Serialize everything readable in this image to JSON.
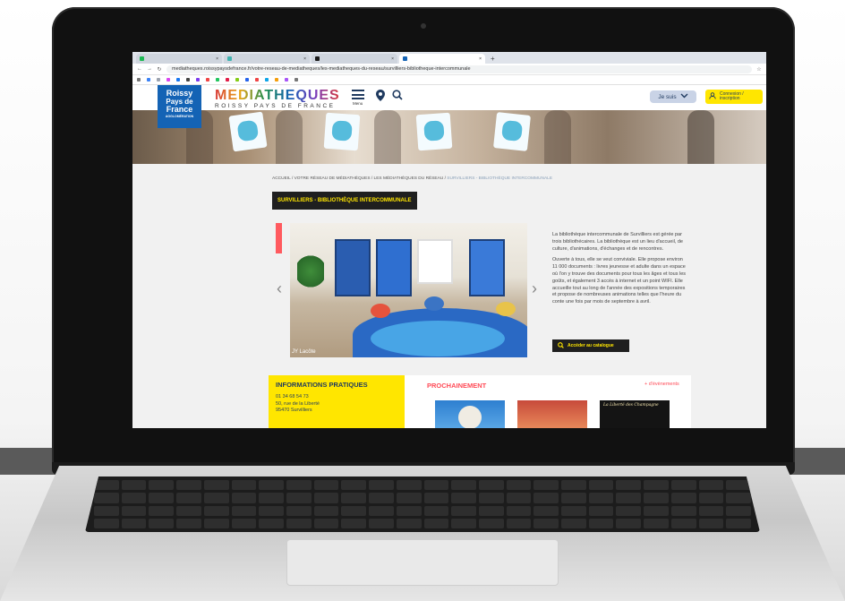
{
  "browser": {
    "tabs": [
      {
        "label": "",
        "active": false,
        "color": "#1db954"
      },
      {
        "label": "",
        "active": false,
        "color": "#3fb3b0"
      },
      {
        "label": "",
        "active": false,
        "color": "#1a1a1a"
      },
      {
        "label": "",
        "active": true,
        "color": "#1463b5"
      }
    ],
    "new_tab_label": "+",
    "url": "mediatheques.roissypaysdefrance.fr/votre-reseau-de-mediatheques/les-mediatheques-du-reseau/survilliers-bibliotheque-intercommunale",
    "bookmarks": []
  },
  "site": {
    "logo": {
      "line1": "Roissy",
      "line2": "Pays de",
      "line3": "France",
      "tagline": "AGGLOMÉRATION"
    },
    "brand_title": "MÉDIATHÈQUES",
    "brand_subtitle": "ROISSY PAYS DE FRANCE",
    "menu_label": "Menu",
    "je_suis_label": "Je suis",
    "connexion_line1": "Connexion /",
    "connexion_line2": "inscription",
    "breadcrumb": {
      "prefix": "ACCUEIL / VOTRE RÉSEAU DE MÉDIATHÈQUES / LES MÉDIATHÈQUES DU RÉSEAU / ",
      "current": "SURVILLIERS - BIBLIOTHÈQUE INTERCOMMUNALE"
    },
    "page_title": "SURVILLIERS - BIBLIOTHÈQUE INTERCOMMUNALE",
    "photo_caption": "JY Lacôte",
    "description_p1": "La bibliothèque intercommunale de Survilliers est gérée par trois bibliothécaires. La bibliothèque est un lieu d'accueil, de culture, d'animations, d'échanges et de rencontres.",
    "description_p2": "Ouverte à tous, elle se veut conviviale. Elle propose environ 11 000 documents : livres jeunesse et adulte dans un espace où l'on y trouve des documents pour tous les âges et tous les goûts, et également 3 accès à internet et un point WIFI. Elle accueille tout au long de l'année des expositions temporaires et propose de nombreuses animations telles que l'heure du conte une fois par mois de septembre à avril.",
    "catalog_button": "Accéder au catalogue",
    "info": {
      "title": "INFORMATIONS PRATIQUES",
      "phone": "01 34 68 54 73",
      "address1": "50, rue de la Liberté",
      "address2": "95470 Survilliers"
    },
    "events_title": "PROCHAINEMENT",
    "events_more": "+ d'évènements",
    "event3_title": "La Liberté des Champagne"
  },
  "colors": {
    "brand_blue": "#1463b5",
    "accent_yellow": "#ffe600",
    "accent_red": "#ff4b57"
  }
}
